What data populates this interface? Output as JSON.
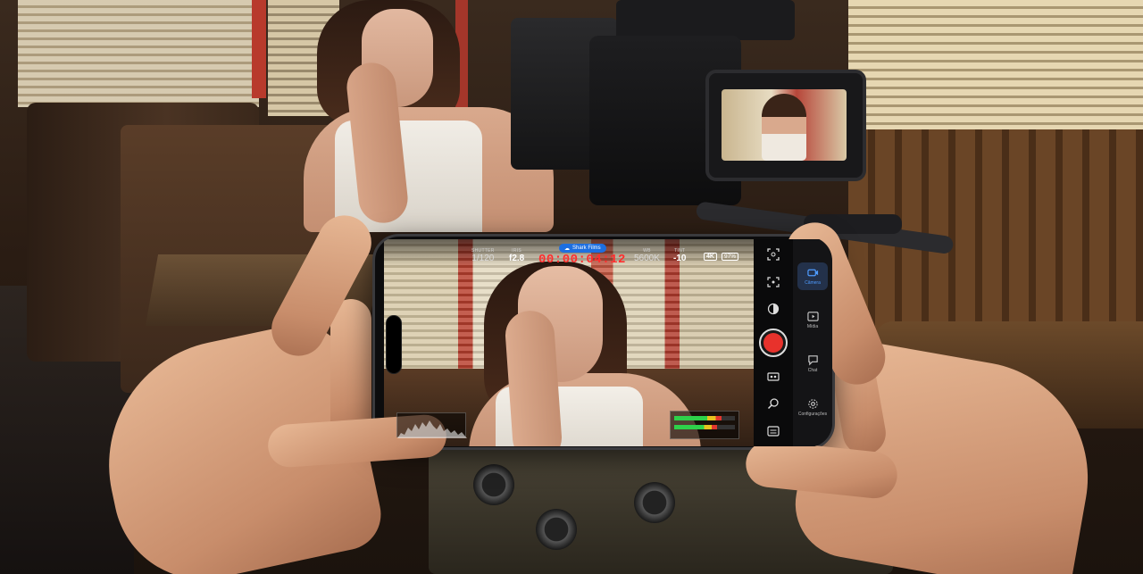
{
  "hud": {
    "shutter_label": "SHUTTER",
    "shutter_value": "1/120",
    "iris_label": "IRIS",
    "iris_value": "f2.8",
    "timecode": "00:00:04:12",
    "wb_label": "WB",
    "wb_value": "5600K",
    "tint_label": "TINT",
    "tint_value": "-10",
    "resolution": "4K",
    "battery": "97%",
    "cloud_label": "Shark Films"
  },
  "audio": {
    "channel_1_level": 0.78,
    "channel_2_level": 0.7
  },
  "controls": {
    "items": [
      "focus-frame-icon",
      "auto-focus-icon",
      "exposure-icon",
      "record-button",
      "face-detect-icon",
      "zoom-icon",
      "menu-icon"
    ]
  },
  "sidenav": {
    "items": [
      {
        "label": "Câmera",
        "icon": "camera-icon",
        "active": true
      },
      {
        "label": "Mídia",
        "icon": "media-icon",
        "active": false
      },
      {
        "label": "Chat",
        "icon": "chat-icon",
        "active": false
      },
      {
        "label": "Configurações",
        "icon": "settings-icon",
        "active": false
      }
    ]
  },
  "colors": {
    "record": "#e8322c",
    "timecode": "#ff2d2d",
    "active_nav": "#4f9cff",
    "cloud_pill": "#1d6fe0"
  }
}
